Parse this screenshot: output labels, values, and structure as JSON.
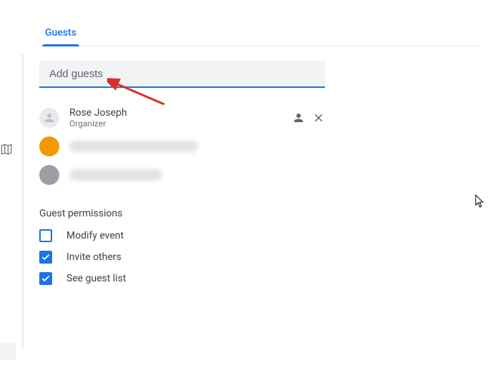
{
  "tab": {
    "label": "Guests"
  },
  "search": {
    "placeholder": "Add guests"
  },
  "guests": {
    "organizer": {
      "name": "Rose Joseph",
      "role": "Organizer"
    }
  },
  "permissions": {
    "title": "Guest permissions",
    "modify": {
      "label": "Modify event"
    },
    "invite": {
      "label": "Invite others"
    },
    "seelist": {
      "label": "See guest list"
    }
  }
}
